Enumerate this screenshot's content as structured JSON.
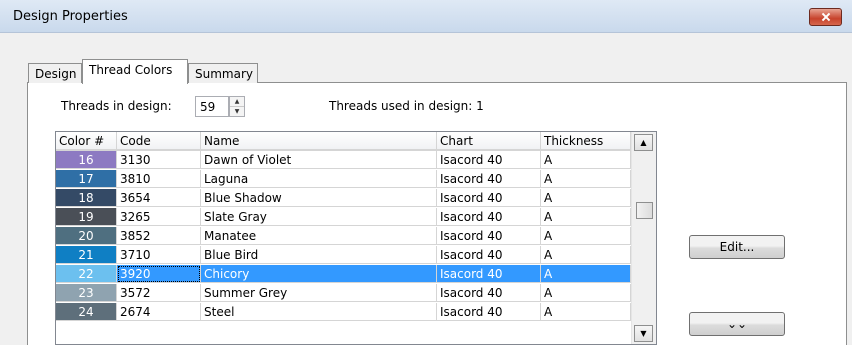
{
  "window": {
    "title": "Design Properties"
  },
  "tabs": [
    {
      "label": "Design",
      "active": false
    },
    {
      "label": "Thread Colors",
      "active": true
    },
    {
      "label": "Summary",
      "active": false
    }
  ],
  "threads_in_design": {
    "label": "Threads in design:",
    "value": "59"
  },
  "threads_used": {
    "label": "Threads used in design: 1"
  },
  "grid": {
    "columns": [
      "Color #",
      "Code",
      "Name",
      "Chart",
      "Thickness"
    ],
    "rows": [
      {
        "num": "16",
        "code": "3130",
        "name": "Dawn of Violet",
        "chart": "Isacord 40",
        "thickness": "A",
        "color": "#8d7ac2",
        "selected": false
      },
      {
        "num": "17",
        "code": "3810",
        "name": "Laguna",
        "chart": "Isacord 40",
        "thickness": "A",
        "color": "#2f6fa6",
        "selected": false
      },
      {
        "num": "18",
        "code": "3654",
        "name": "Blue Shadow",
        "chart": "Isacord 40",
        "thickness": "A",
        "color": "#344a66",
        "selected": false
      },
      {
        "num": "19",
        "code": "3265",
        "name": "Slate Gray",
        "chart": "Isacord 40",
        "thickness": "A",
        "color": "#4a4f57",
        "selected": false
      },
      {
        "num": "20",
        "code": "3852",
        "name": "Manatee",
        "chart": "Isacord 40",
        "thickness": "A",
        "color": "#4f6f80",
        "selected": false
      },
      {
        "num": "21",
        "code": "3710",
        "name": "Blue Bird",
        "chart": "Isacord 40",
        "thickness": "A",
        "color": "#0f7fc4",
        "selected": false
      },
      {
        "num": "22",
        "code": "3920",
        "name": "Chicory",
        "chart": "Isacord 40",
        "thickness": "A",
        "color": "#6cc0ef",
        "selected": true
      },
      {
        "num": "23",
        "code": "3572",
        "name": "Summer Grey",
        "chart": "Isacord 40",
        "thickness": "A",
        "color": "#8fa3b0",
        "selected": false
      },
      {
        "num": "24",
        "code": "2674",
        "name": "Steel",
        "chart": "Isacord 40",
        "thickness": "A",
        "color": "#5e6f7b",
        "selected": false
      }
    ]
  },
  "buttons": {
    "edit": "Edit...",
    "more": "⌄⌄"
  }
}
